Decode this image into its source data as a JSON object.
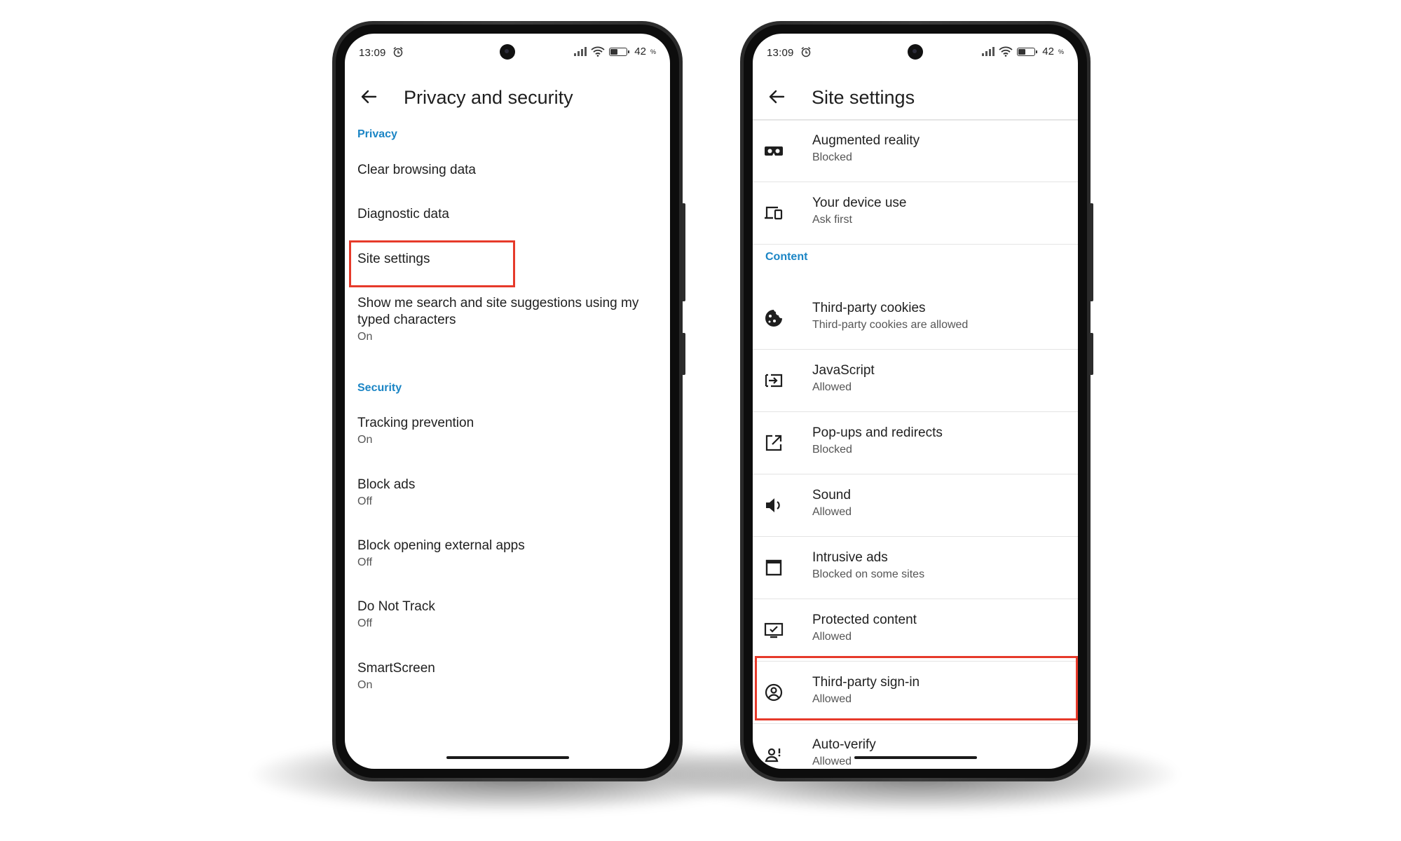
{
  "status": {
    "time": "13:09",
    "battery": "42"
  },
  "left": {
    "title": "Privacy and security",
    "privacy_header": "Privacy",
    "clear_browsing": "Clear browsing data",
    "diagnostic": "Diagnostic data",
    "site_settings": "Site settings",
    "suggestions_title": "Show me search and site suggestions using my typed characters",
    "suggestions_value": "On",
    "security_header": "Security",
    "tracking_title": "Tracking prevention",
    "tracking_value": "On",
    "block_ads_title": "Block ads",
    "block_ads_value": "Off",
    "external_apps_title": "Block opening external apps",
    "external_apps_value": "Off",
    "dnt_title": "Do Not Track",
    "dnt_value": "Off",
    "smartscreen_title": "SmartScreen",
    "smartscreen_value": "On"
  },
  "right": {
    "title": "Site settings",
    "content_header": "Content",
    "ar_title": "Augmented reality",
    "ar_value": "Blocked",
    "device_title": "Your device use",
    "device_value": "Ask first",
    "cookies_title": "Third-party cookies",
    "cookies_value": "Third-party cookies are allowed",
    "js_title": "JavaScript",
    "js_value": "Allowed",
    "popups_title": "Pop-ups and redirects",
    "popups_value": "Blocked",
    "sound_title": "Sound",
    "sound_value": "Allowed",
    "intrusive_title": "Intrusive ads",
    "intrusive_value": "Blocked on some sites",
    "protected_title": "Protected content",
    "protected_value": "Allowed",
    "signin_title": "Third-party sign-in",
    "signin_value": "Allowed",
    "autoverify_title": "Auto-verify",
    "autoverify_value": "Allowed"
  },
  "colors": {
    "accent": "#1b85c5",
    "highlight": "#e63a2a"
  }
}
